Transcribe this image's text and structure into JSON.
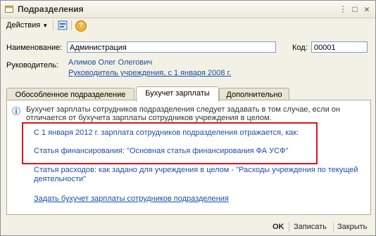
{
  "window": {
    "title": "Подразделения",
    "close_glyph": "×",
    "maximize_glyph": "□",
    "menu_glyph": "⋮"
  },
  "toolbar": {
    "actions_label": "Действия",
    "help_glyph": "?"
  },
  "form": {
    "name_label": "Наименование:",
    "name_value": "Администрация",
    "code_label": "Код:",
    "code_value": "00001",
    "manager_label": "Руководитель:",
    "manager_name": "Алимов Олег Олегович",
    "manager_position": "Руководитель учреждения, с 1 января 2008 г."
  },
  "tabs": [
    {
      "label": "Обособленное подразделение"
    },
    {
      "label": "Бухучет зарплаты"
    },
    {
      "label": "Дополнительно"
    }
  ],
  "panel": {
    "info_text": "Бухучет зарплаты сотрудников подразделения следует задавать в том случае, если он отличается от бухучета зарплаты сотрудников учреждения в целом.",
    "line1": "С 1 января 2012 г. зарплата сотрудников подразделения отражается, как:",
    "line2": "Статья финансирования: \"Основная статья финансирования ФА УСФ\"",
    "line3a": "Статья расходов: как задано для учреждения в целом - \"Расходы учреждения по текущей",
    "line3b": "деятельности\"",
    "link": "Задать бухучет зарплаты сотрудников подразделения"
  },
  "footer": {
    "ok": "OK",
    "save": "Записать",
    "close": "Закрыть"
  },
  "colors": {
    "highlight": "#e0121b",
    "link": "#1c4ea8"
  }
}
